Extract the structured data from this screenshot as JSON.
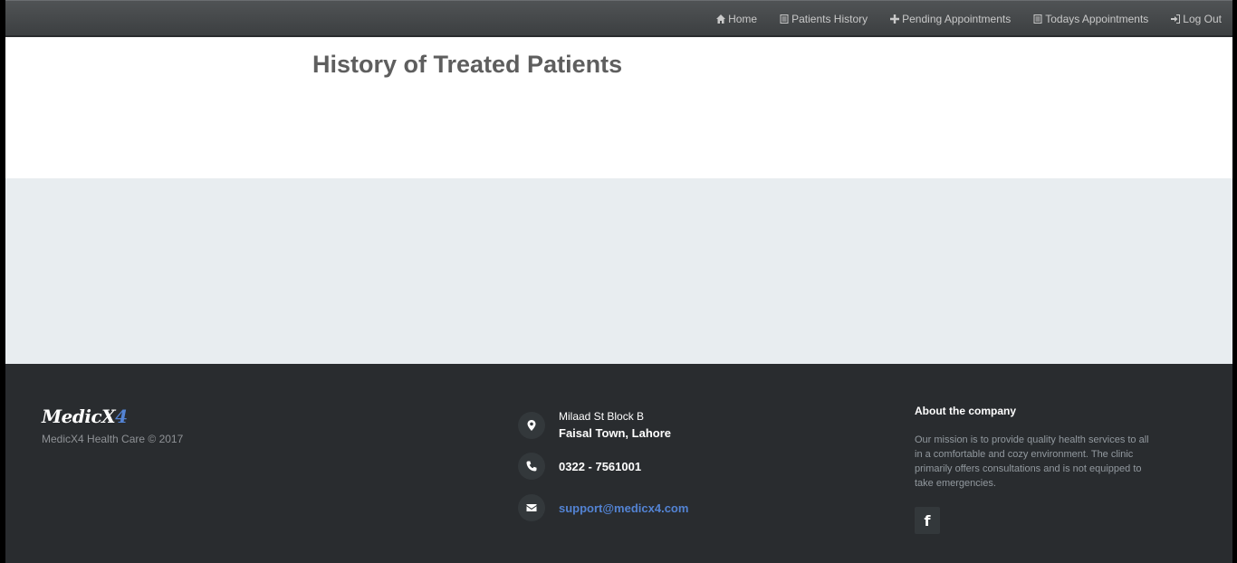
{
  "nav": {
    "items": [
      {
        "label": "Home",
        "icon": "home-icon"
      },
      {
        "label": "Patients History",
        "icon": "list-icon"
      },
      {
        "label": "Pending Appointments",
        "icon": "plus-icon"
      },
      {
        "label": "Todays Appointments",
        "icon": "list-icon"
      },
      {
        "label": "Log Out",
        "icon": "logout-icon"
      }
    ]
  },
  "main": {
    "title": "History of Treated Patients"
  },
  "footer": {
    "logo_main": "MedicX",
    "logo_accent": "4",
    "copyright": "MedicX4 Health Care © 2017",
    "address_line1": "Milaad St Block B",
    "address_line2": "Faisal Town, Lahore",
    "phone": "0322 - 7561001",
    "email": "support@medicx4.com",
    "about_title": "About the company",
    "about_text": "Our mission is to provide quality health services to all in a comfortable and cozy environment. The clinic primarily offers consultations and is not equipped to take emergencies.",
    "social_icon": "f"
  },
  "colors": {
    "navbar": "#45484a",
    "footer_bg": "#292c2f",
    "accent": "#5383d3",
    "band": "#e8edf0"
  }
}
